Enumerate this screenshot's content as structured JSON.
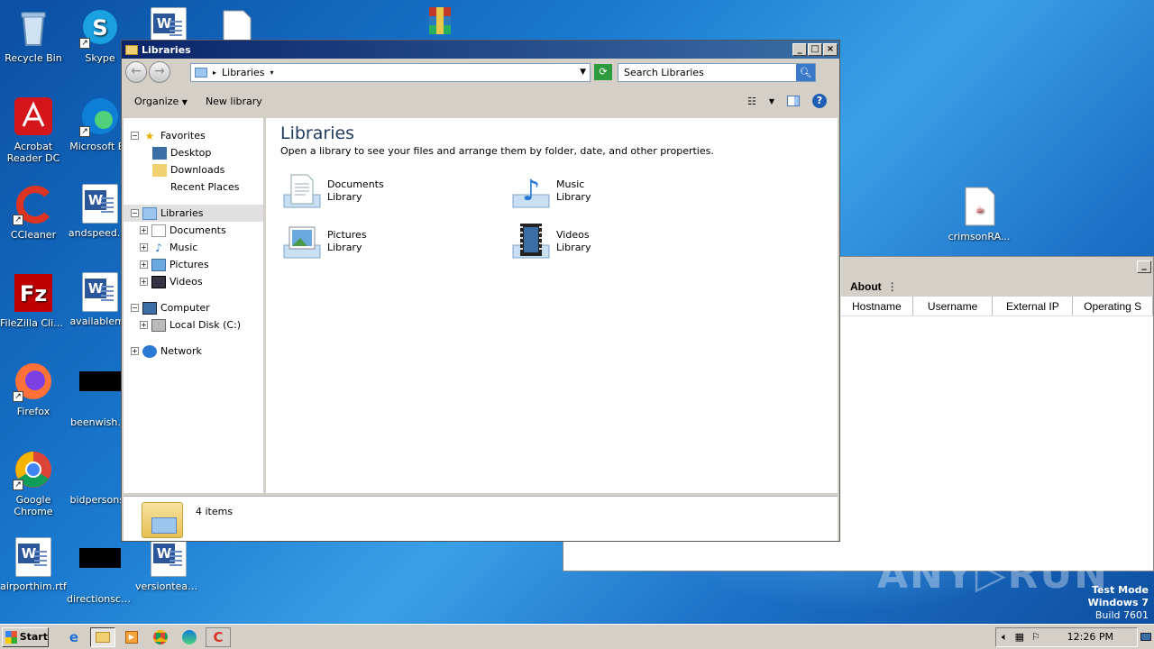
{
  "desktop": {
    "icons": [
      {
        "label": "Recycle Bin"
      },
      {
        "label": "Skype"
      },
      {
        "label": "Acrobat Reader DC"
      },
      {
        "label": "Microsoft Ed"
      },
      {
        "label": "CCleaner"
      },
      {
        "label": "andspeed.rtf"
      },
      {
        "label": "FileZilla Client"
      },
      {
        "label": "availablema"
      },
      {
        "label": "Firefox"
      },
      {
        "label": "beenwish.jp"
      },
      {
        "label": "Google Chrome"
      },
      {
        "label": "bidpersons.j"
      },
      {
        "label": "airporthim.rtf"
      },
      {
        "label": "directionscli..."
      },
      {
        "label": "versionteam..."
      },
      {
        "label": "crimsonRA..."
      }
    ]
  },
  "explorer": {
    "title": "Libraries",
    "address": "Libraries",
    "search_placeholder": "Search Libraries",
    "commands": {
      "organize": "Organize",
      "new_library": "New library"
    },
    "nav": {
      "favorites": "Favorites",
      "desktop": "Desktop",
      "downloads": "Downloads",
      "recent": "Recent Places",
      "libraries": "Libraries",
      "documents": "Documents",
      "music": "Music",
      "pictures": "Pictures",
      "videos": "Videos",
      "computer": "Computer",
      "local_disk": "Local Disk (C:)",
      "network": "Network"
    },
    "content": {
      "heading": "Libraries",
      "subtitle": "Open a library to see your files and arrange them by folder, date, and other properties.",
      "libraries": [
        {
          "name": "Documents",
          "type": "Library"
        },
        {
          "name": "Music",
          "type": "Library"
        },
        {
          "name": "Pictures",
          "type": "Library"
        },
        {
          "name": "Videos",
          "type": "Library"
        }
      ]
    },
    "status": "4 items"
  },
  "back_window": {
    "tab": "About",
    "columns": [
      "Hostname",
      "Username",
      "External IP",
      "Operating S"
    ]
  },
  "taskbar": {
    "start": "Start",
    "clock": "12:26 PM"
  },
  "overlay": {
    "watermark": "ANY▷RUN",
    "mode_line1": "Test Mode",
    "mode_line2": "Windows 7",
    "mode_line3": "Build 7601"
  }
}
